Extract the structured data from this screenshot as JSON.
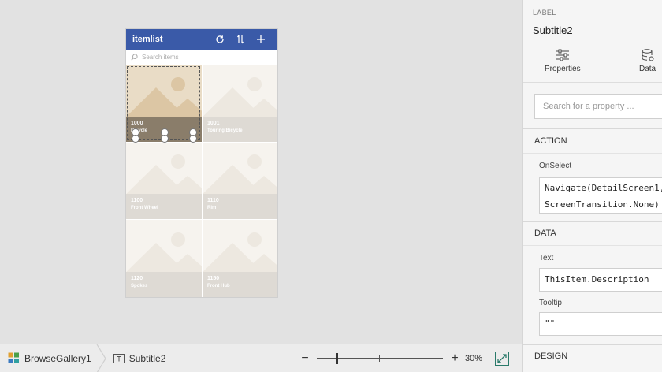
{
  "app": {
    "title": "itemlist",
    "search_placeholder": "Search items",
    "icons": {
      "refresh": "refresh-icon",
      "sort": "sort-icon",
      "add": "plus-icon",
      "search": "search-icon"
    },
    "header_color": "#3a5aa8"
  },
  "gallery": {
    "items": [
      {
        "number": "1000",
        "description": "Bicycle",
        "selected": true
      },
      {
        "number": "1001",
        "description": "Touring Bicycle"
      },
      {
        "number": "1100",
        "description": "Front Wheel"
      },
      {
        "number": "1110",
        "description": "Rim"
      },
      {
        "number": "1120",
        "description": "Spokes"
      },
      {
        "number": "1150",
        "description": "Front Hub"
      }
    ]
  },
  "bottombar": {
    "breadcrumb": [
      {
        "label": "BrowseGallery1",
        "icon": "gallery-icon"
      },
      {
        "label": "Subtitle2",
        "icon": "label-icon"
      }
    ],
    "zoom_percent": "30%",
    "zoom_level": 30
  },
  "panel": {
    "label_caption": "LABEL",
    "control_name": "Subtitle2",
    "tabs": [
      {
        "label": "Properties",
        "icon": "sliders-icon"
      },
      {
        "label": "Data",
        "icon": "database-icon"
      }
    ],
    "search_placeholder": "Search for a property ...",
    "sections": {
      "action": "ACTION",
      "data": "DATA",
      "design": "DESIGN"
    },
    "fields": {
      "onselect_label": "OnSelect",
      "onselect_line1": "Navigate(DetailScreen1,",
      "onselect_line2": "ScreenTransition.None)",
      "text_label": "Text",
      "text_value": "ThisItem.Description",
      "tooltip_label": "Tooltip",
      "tooltip_value": "\"\""
    }
  }
}
